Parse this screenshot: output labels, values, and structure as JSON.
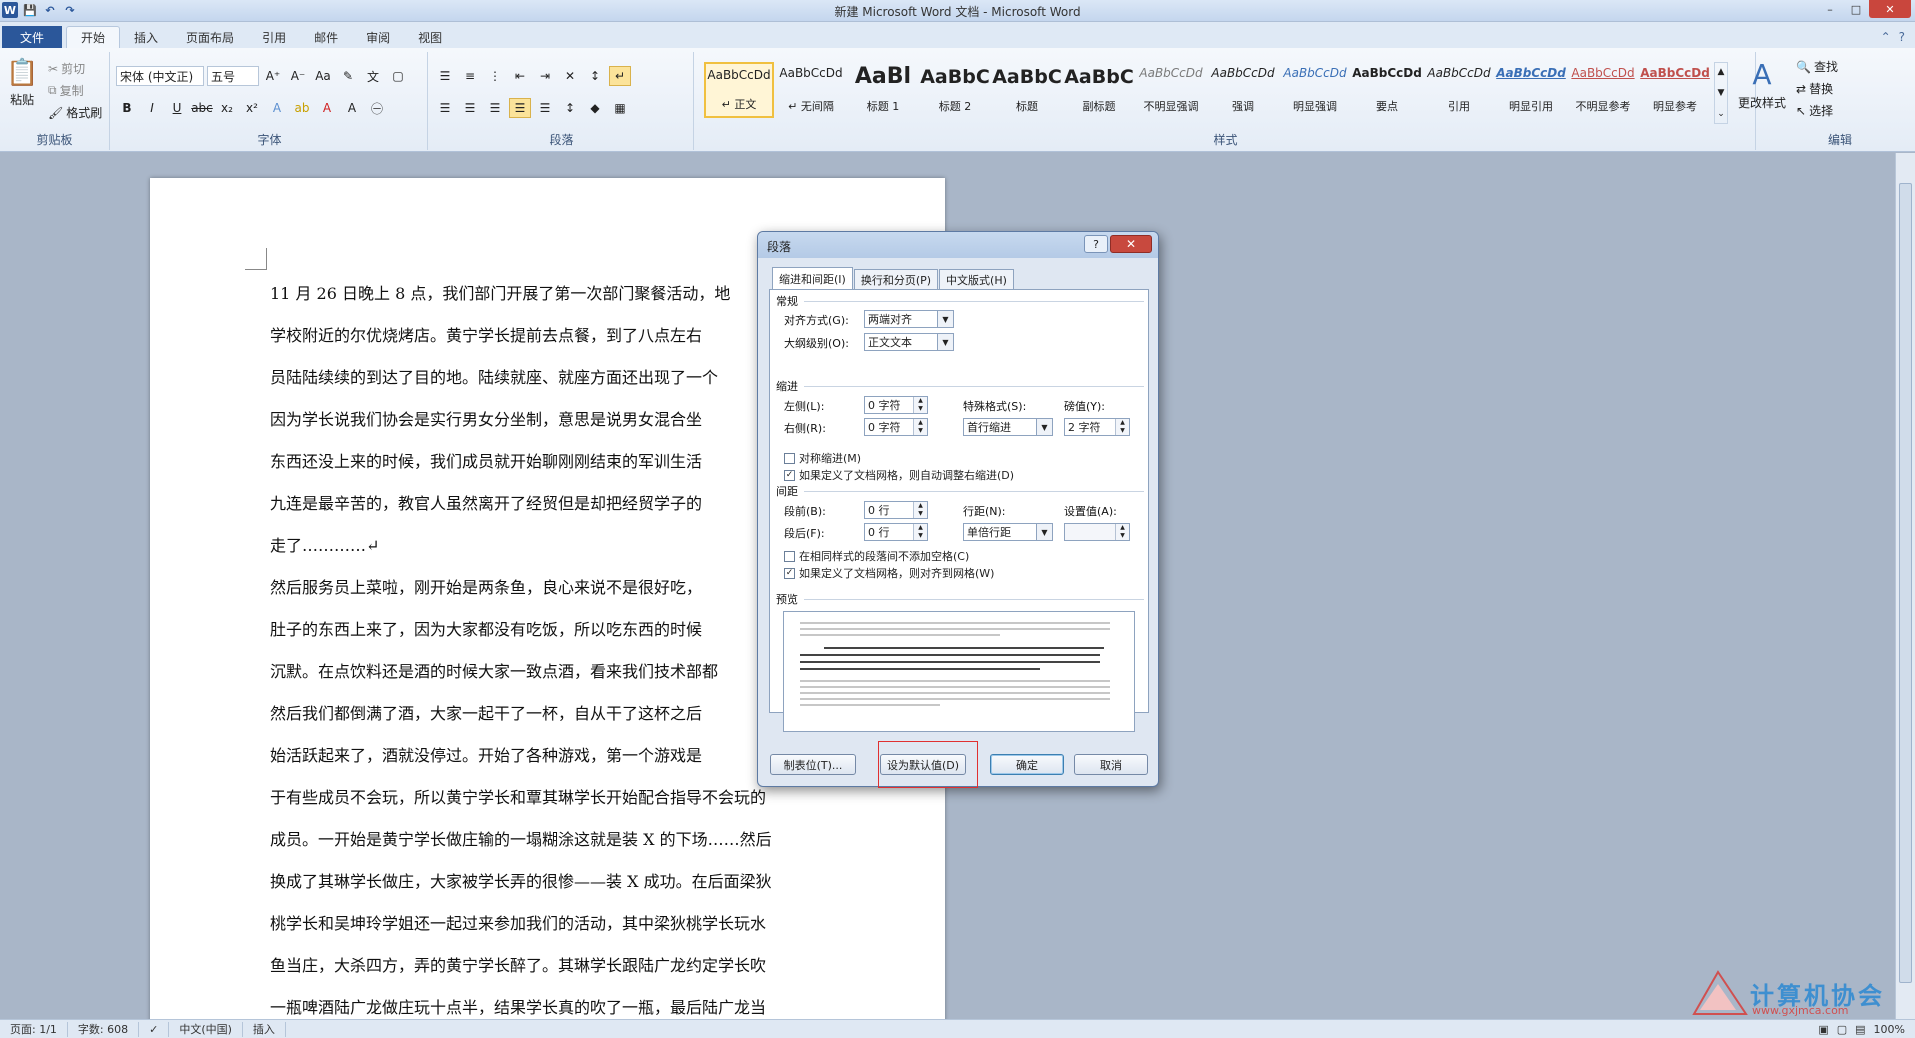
{
  "window": {
    "title": "新建 Microsoft Word 文档 - Microsoft Word",
    "min": "–",
    "max": "□",
    "close": "✕"
  },
  "qat": {
    "word_icon": "W",
    "save": "💾",
    "undo": "↶",
    "redo": "↷"
  },
  "tabs": [
    {
      "label": "文件"
    },
    {
      "label": "开始"
    },
    {
      "label": "插入"
    },
    {
      "label": "页面布局"
    },
    {
      "label": "引用"
    },
    {
      "label": "邮件"
    },
    {
      "label": "审阅"
    },
    {
      "label": "视图"
    }
  ],
  "ribbon": {
    "clipboard": {
      "paste": "粘贴",
      "cut": "剪切",
      "copy": "复制",
      "format_painter": "格式刷",
      "group": "剪贴板"
    },
    "font": {
      "family": "宋体 (中文正)",
      "size": "五号",
      "group": "字体"
    },
    "paragraph": {
      "group": "段落"
    },
    "styles": {
      "group": "样式",
      "items": [
        {
          "sample": "AaBbCcDd",
          "name": "↵ 正文"
        },
        {
          "sample": "AaBbCcDd",
          "name": "↵ 无间隔"
        },
        {
          "sample": "AaBl",
          "name": "标题 1"
        },
        {
          "sample": "AaBbC",
          "name": "标题 2"
        },
        {
          "sample": "AaBbC",
          "name": "标题"
        },
        {
          "sample": "AaBbC",
          "name": "副标题"
        },
        {
          "sample": "AaBbCcDd",
          "name": "不明显强调"
        },
        {
          "sample": "AaBbCcDd",
          "name": "强调"
        },
        {
          "sample": "AaBbCcDd",
          "name": "明显强调"
        },
        {
          "sample": "AaBbCcDd",
          "name": "要点"
        },
        {
          "sample": "AaBbCcDd",
          "name": "引用"
        },
        {
          "sample": "AaBbCcDd",
          "name": "明显引用"
        },
        {
          "sample": "AaBbCcDd",
          "name": "不明显参考"
        },
        {
          "sample": "AaBbCcDd",
          "name": "明显参考"
        }
      ],
      "change_styles": "更改样式"
    },
    "editing": {
      "find": "查找",
      "replace": "替换",
      "select": "选择",
      "group": "编辑"
    }
  },
  "document": {
    "lines": [
      "11 月 26 日晚上 8 点，我们部门开展了第一次部门聚餐活动，地",
      "学校附近的尔优烧烤店。黄宁学长提前去点餐，到了八点左右",
      "员陆陆续续的到达了目的地。陆续就座、就座方面还出现了一个",
      "因为学长说我们协会是实行男女分坐制，意思是说男女混合坐",
      "东西还没上来的时候，我们成员就开始聊刚刚结束的军训生活",
      "九连是最辛苦的，教官人虽然离开了经贸但是却把经贸学子的",
      "走了…………↵",
      "然后服务员上菜啦，刚开始是两条鱼，良心来说不是很好吃，",
      "肚子的东西上来了，因为大家都没有吃饭，所以吃东西的时候",
      "沉默。在点饮料还是酒的时候大家一致点酒，看来我们技术部都",
      "然后我们都倒满了酒，大家一起干了一杯，自从干了这杯之后",
      "始活跃起来了，酒就没停过。开始了各种游戏，第一个游戏是",
      "于有些成员不会玩，所以黄宁学长和覃其琳学长开始配合指导不会玩的",
      "成员。一开始是黄宁学长做庄输的一塌糊涂这就是装 X 的下场……然后",
      "换成了其琳学长做庄，大家被学长弄的很惨——装 X 成功。在后面梁狄",
      "桃学长和吴坤玲学姐还一起过来参加我们的活动，其中梁狄桃学长玩水",
      "鱼当庄，大杀四方，弄的黄宁学长醉了。其琳学长跟陆广龙约定学长吹",
      "一瓶啤酒陆广龙做庄玩十点半，结果学长真的吹了一瓶，最后陆广龙当"
    ]
  },
  "statusbar": {
    "page": "页面: 1/1",
    "words": "字数: 608",
    "lang": "中文(中国)",
    "mode": "插入",
    "zoom": "100%"
  },
  "dialog": {
    "title": "段落",
    "help": "?",
    "close": "✕",
    "tabs": [
      "缩进和间距(I)",
      "换行和分页(P)",
      "中文版式(H)"
    ],
    "general": {
      "heading": "常规",
      "align_label": "对齐方式(G):",
      "align_value": "两端对齐",
      "outline_label": "大纲级别(O):",
      "outline_value": "正文文本"
    },
    "indent": {
      "heading": "缩进",
      "left_label": "左侧(L):",
      "left_value": "0 字符",
      "right_label": "右侧(R):",
      "right_value": "0 字符",
      "special_label": "特殊格式(S):",
      "special_value": "首行缩进",
      "by_label": "磅值(Y):",
      "by_value": "2 字符",
      "mirror": "对称缩进(M)",
      "auto_adjust": "如果定义了文档网格，则自动调整右缩进(D)"
    },
    "spacing": {
      "heading": "间距",
      "before_label": "段前(B):",
      "before_value": "0 行",
      "after_label": "段后(F):",
      "after_value": "0 行",
      "line_label": "行距(N):",
      "line_value": "单倍行距",
      "at_label": "设置值(A):",
      "at_value": "",
      "no_space_same": "在相同样式的段落间不添加空格(C)",
      "snap_grid": "如果定义了文档网格，则对齐到网格(W)"
    },
    "preview": {
      "heading": "预览"
    },
    "buttons": {
      "tabs": "制表位(T)...",
      "default": "设为默认值(D)",
      "ok": "确定",
      "cancel": "取消"
    }
  },
  "watermark": {
    "main": "计算机协会",
    "url": "www.gxjmca.com"
  },
  "colors": {
    "file_tab": "#2b579a",
    "highlight_box": "#e03030",
    "accent": "#3e8fd0"
  }
}
